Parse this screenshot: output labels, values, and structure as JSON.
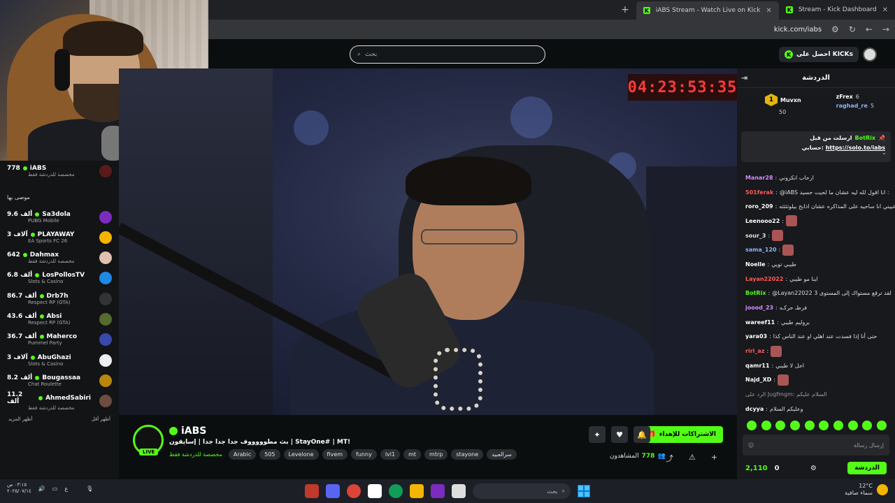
{
  "browser": {
    "tabs": [
      {
        "title": "iABS Stream - Watch Live on Kick",
        "active": true
      },
      {
        "title": "Stream - Kick Dashboard",
        "active": false
      }
    ],
    "url": "kick.com/iabs"
  },
  "kick": {
    "search_placeholder": "بحث",
    "get_kicks": "احصل على KICKs",
    "accent": "#53fc18"
  },
  "sidebar": {
    "me": {
      "name": "iABS",
      "count": "778",
      "category": "مخصصة للدردشة فقط"
    },
    "recommended_title": "موصى بها",
    "channels": [
      {
        "name": "Sa3dola",
        "viewers": "9.6 ألف",
        "category": "PUBG Mobile",
        "color": "#7b2cbf"
      },
      {
        "name": "PLAYAWAY",
        "viewers": "3 آلاف",
        "category": "EA Sports FC 26",
        "color": "#f4b400"
      },
      {
        "name": "Dahmax",
        "viewers": "642",
        "category": "مخصصة للدردشة فقط",
        "color": "#e0c0b0"
      },
      {
        "name": "LosPollosTV",
        "viewers": "6.8 ألف",
        "category": "Slots & Casino",
        "color": "#1e88e5"
      },
      {
        "name": "Drb7h",
        "viewers": "86.7 ألف",
        "category": "Respect RP (GTA)",
        "color": "#333333"
      },
      {
        "name": "Absi",
        "viewers": "43.6 ألف",
        "category": "Respect RP (GTA)",
        "color": "#556b2f"
      },
      {
        "name": "Maherco",
        "viewers": "36.7 ألف",
        "category": "Pummel Party",
        "color": "#3949ab"
      },
      {
        "name": "AbuGhazi",
        "viewers": "3 آلاف",
        "category": "Slots & Casino",
        "color": "#eeeeee"
      },
      {
        "name": "Bougassaa",
        "viewers": "8.2 ألف",
        "category": "Chat Roulette",
        "color": "#b8860b"
      },
      {
        "name": "AhmedSabiri",
        "viewers": "11.2 ألف",
        "category": "مخصصة للدردشة فقط",
        "color": "#6d4c41"
      }
    ],
    "show_more": "أظهر المزيد",
    "show_less": "أظهر أقل"
  },
  "video": {
    "timer": "04:23:53:35"
  },
  "stream": {
    "name": "iABS",
    "title": "بث مطوووووف جدا جدا جدا | إسايقون | StayOne# | MT!",
    "category": "مخصصة للدردشة فقط",
    "tags": [
      "Arabic",
      "505",
      "Levelone",
      "fivem",
      "funny",
      "lvl1",
      "mt",
      "mtrp",
      "stayone",
      "سرالعبيد"
    ],
    "live": "LIVE",
    "subscribe_gift": "الاشتراكات للإهداء",
    "viewers_label": "المشاهدون",
    "viewers": "778"
  },
  "chat": {
    "title": "الدردشة",
    "leaderboard": [
      {
        "rank": "1",
        "name": "Muvxn",
        "value": "50"
      },
      {
        "name": "zFrex",
        "value": "6"
      },
      {
        "name": "raghad_re",
        "value": "5"
      }
    ],
    "pinned": {
      "by": "BotRix",
      "label": "ارسلت من قبل",
      "prefix": "حسابي:",
      "link": "https://solo.to/iabs"
    },
    "messages": [
      {
        "user": "Manar28",
        "text": "ارحاب انكروني",
        "color": "#d58bff"
      },
      {
        "user": "501ferak",
        "text": "@iABS انا اقول لله ليه عشان ما لحيت حسيد :",
        "color": "#ff5a5a"
      },
      {
        "user": "roro_209",
        "text": "ادعييني انا ساحيه على المذاكره عشان اذابح بيلوثثثثه",
        "color": "#ffffff"
      },
      {
        "user": "Leenooo22",
        "text": "",
        "color": "#ffffff",
        "emote": true
      },
      {
        "user": "sour_3",
        "text": "",
        "color": "#e0e0e0",
        "emote": true
      },
      {
        "user": "sama_120",
        "text": "",
        "color": "#8ab4ff",
        "emote": true
      },
      {
        "user": "Noelle",
        "text": "طيبي تويي",
        "color": "#ffffff"
      },
      {
        "user": "Layan22022",
        "text": "اينا مو طيبي",
        "color": "#ff5a5a"
      },
      {
        "user": "BotRix",
        "text": "@Layan22022 لقد ترقع مستواك إلى المستوى 3",
        "color": "#53fc18"
      },
      {
        "user": "joood_23",
        "text": "فرطـ حركـه",
        "color": "#d58bff"
      },
      {
        "user": "wareef11",
        "text": "بروليم طيبي",
        "color": "#ffffff"
      },
      {
        "user": "yara03",
        "text": "حتى أنا إذا فسدت عند اهلي او عند الناس كذا",
        "color": "#ffffff"
      },
      {
        "user": "riri_az",
        "text": "",
        "color": "#ff5a5a",
        "emote": true
      },
      {
        "user": "qamr11",
        "text": "اجل لا طيبي",
        "color": "#ffffff"
      },
      {
        "user": "Najd_XD",
        "text": "",
        "color": "#ffffff",
        "emote": true
      },
      {
        "user": "",
        "text": "الرد على Jugfmgm: السلام عليكم",
        "color": "#999999"
      },
      {
        "user": "dcyya",
        "text": "وعليكم السلام",
        "color": "#ffffff"
      }
    ],
    "input_placeholder": "إرسال رسالة",
    "points": "2,110",
    "zero": "0",
    "send": "الدردشة"
  },
  "taskbar": {
    "time": "٠٣:١٥ ص",
    "date": "٢٠٢٥/٠٧/١٤",
    "lang": "ع",
    "search": "بحث",
    "weather_temp": "12°C",
    "weather_desc": "سماء صافية"
  }
}
